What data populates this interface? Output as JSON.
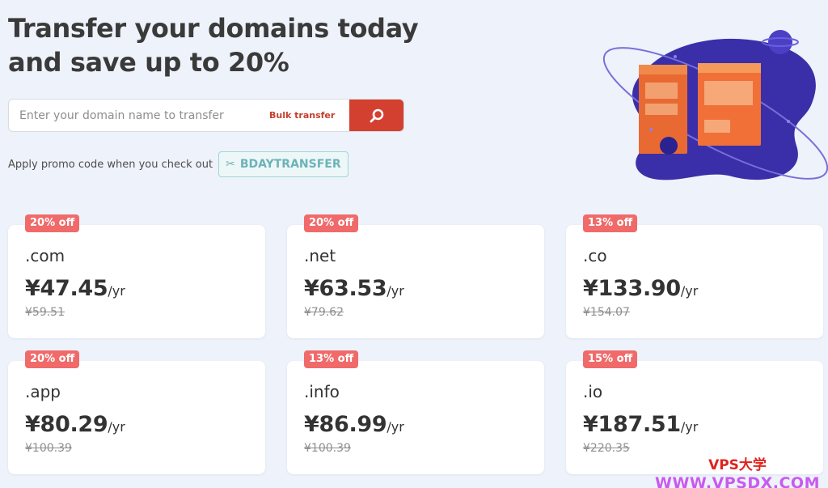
{
  "hero": {
    "title_line1": "Transfer your domains today",
    "title_line2": "and save up to 20%"
  },
  "search": {
    "placeholder": "Enter your domain name to transfer",
    "value": "",
    "bulk_label": "Bulk transfer",
    "button_icon": "search-icon"
  },
  "promo": {
    "text": "Apply promo code when you check out",
    "icon": "scissors-icon",
    "code": "BDAYTRANSFER"
  },
  "cards": [
    {
      "badge": "20% off",
      "tld": ".com",
      "price": "¥47.45",
      "per": "/yr",
      "old_price": "¥59.51"
    },
    {
      "badge": "20% off",
      "tld": ".net",
      "price": "¥63.53",
      "per": "/yr",
      "old_price": "¥79.62"
    },
    {
      "badge": "13% off",
      "tld": ".co",
      "price": "¥133.90",
      "per": "/yr",
      "old_price": "¥154.07"
    },
    {
      "badge": "20% off",
      "tld": ".app",
      "price": "¥80.29",
      "per": "/yr",
      "old_price": "¥100.39"
    },
    {
      "badge": "13% off",
      "tld": ".info",
      "price": "¥86.99",
      "per": "/yr",
      "old_price": "¥100.39"
    },
    {
      "badge": "15% off",
      "tld": ".io",
      "price": "¥187.51",
      "per": "/yr",
      "old_price": "¥220.35"
    }
  ],
  "watermark": {
    "line1": "VPS大学",
    "line2": "WWW.VPSDX.COM"
  },
  "colors": {
    "background": "#eef2fa",
    "accent": "#d3402f",
    "badge": "#f06a6a",
    "promo_code": "#6cb3b8",
    "illustration_blob": "#3a2fa8",
    "illustration_window": "#f0703a"
  }
}
